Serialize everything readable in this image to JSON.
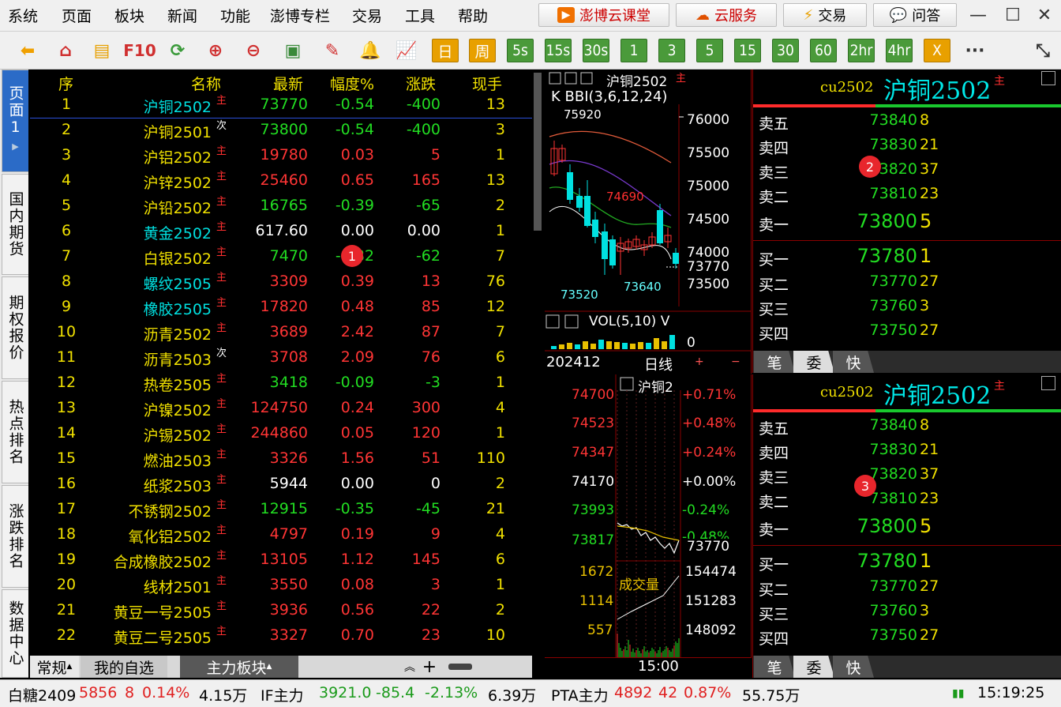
{
  "menu": [
    "系统",
    "页面",
    "板块",
    "新闻",
    "功能",
    "澎博专栏",
    "交易",
    "工具",
    "帮助"
  ],
  "top_buttons": {
    "classroom": "澎博云课堂",
    "cloud": "云服务",
    "trade": "交易",
    "qa": "问答"
  },
  "toolbar_periods": [
    "日",
    "周",
    "5s",
    "15s",
    "30s",
    "1",
    "3",
    "5",
    "15",
    "30",
    "60",
    "2hr",
    "4hr",
    "X"
  ],
  "toolbar_f10": "F10",
  "toolbar_more": "···",
  "side_tabs": [
    {
      "label": "页面1"
    },
    {
      "label": "国内期货"
    },
    {
      "label": "期权报价"
    },
    {
      "label": "热点排名"
    },
    {
      "label": "涨跌排名"
    },
    {
      "label": "数据中心"
    }
  ],
  "table": {
    "headers": {
      "seq": "序",
      "name": "名称",
      "last": "最新",
      "pct": "幅度%",
      "chg": "涨跌",
      "vol": "现手"
    },
    "rows": [
      {
        "seq": "1",
        "name": "沪铜2502",
        "tag": "主",
        "last": "73770",
        "pct": "-0.54",
        "chg": "-400",
        "vol": "13",
        "dir": "down"
      },
      {
        "seq": "2",
        "name": "沪铜2501",
        "tag": "次",
        "last": "73800",
        "pct": "-0.54",
        "chg": "-400",
        "vol": "3",
        "dir": "down"
      },
      {
        "seq": "3",
        "name": "沪铝2502",
        "tag": "主",
        "last": "19780",
        "pct": "0.03",
        "chg": "5",
        "vol": "1",
        "dir": "up"
      },
      {
        "seq": "4",
        "name": "沪锌2502",
        "tag": "主",
        "last": "25460",
        "pct": "0.65",
        "chg": "165",
        "vol": "13",
        "dir": "up"
      },
      {
        "seq": "5",
        "name": "沪铅2502",
        "tag": "主",
        "last": "16765",
        "pct": "-0.39",
        "chg": "-65",
        "vol": "2",
        "dir": "down"
      },
      {
        "seq": "6",
        "name": "黄金2502",
        "tag": "主",
        "last": "617.60",
        "pct": "0.00",
        "chg": "0.00",
        "vol": "1",
        "dir": "flat"
      },
      {
        "seq": "7",
        "name": "白银2502",
        "tag": "主",
        "last": "7470",
        "pct": "-0.82",
        "chg": "-62",
        "vol": "7",
        "dir": "down"
      },
      {
        "seq": "8",
        "name": "螺纹2505",
        "tag": "主",
        "last": "3309",
        "pct": "0.39",
        "chg": "13",
        "vol": "76",
        "dir": "up"
      },
      {
        "seq": "9",
        "name": "橡胶2505",
        "tag": "主",
        "last": "17820",
        "pct": "0.48",
        "chg": "85",
        "vol": "12",
        "dir": "up"
      },
      {
        "seq": "10",
        "name": "沥青2502",
        "tag": "主",
        "last": "3689",
        "pct": "2.42",
        "chg": "87",
        "vol": "7",
        "dir": "up"
      },
      {
        "seq": "11",
        "name": "沥青2503",
        "tag": "次",
        "last": "3708",
        "pct": "2.09",
        "chg": "76",
        "vol": "6",
        "dir": "up"
      },
      {
        "seq": "12",
        "name": "热卷2505",
        "tag": "主",
        "last": "3418",
        "pct": "-0.09",
        "chg": "-3",
        "vol": "1",
        "dir": "down"
      },
      {
        "seq": "13",
        "name": "沪镍2502",
        "tag": "主",
        "last": "124750",
        "pct": "0.24",
        "chg": "300",
        "vol": "4",
        "dir": "up"
      },
      {
        "seq": "14",
        "name": "沪锡2502",
        "tag": "主",
        "last": "244860",
        "pct": "0.05",
        "chg": "120",
        "vol": "1",
        "dir": "up"
      },
      {
        "seq": "15",
        "name": "燃油2503",
        "tag": "主",
        "last": "3326",
        "pct": "1.56",
        "chg": "51",
        "vol": "110",
        "dir": "up"
      },
      {
        "seq": "16",
        "name": "纸浆2503",
        "tag": "主",
        "last": "5944",
        "pct": "0.00",
        "chg": "0",
        "vol": "2",
        "dir": "flat"
      },
      {
        "seq": "17",
        "name": "不锈钢2502",
        "tag": "主",
        "last": "12915",
        "pct": "-0.35",
        "chg": "-45",
        "vol": "21",
        "dir": "down"
      },
      {
        "seq": "18",
        "name": "氧化铝2502",
        "tag": "主",
        "last": "4797",
        "pct": "0.19",
        "chg": "9",
        "vol": "4",
        "dir": "up"
      },
      {
        "seq": "19",
        "name": "合成橡胶2502",
        "tag": "主",
        "last": "13105",
        "pct": "1.12",
        "chg": "145",
        "vol": "6",
        "dir": "up"
      },
      {
        "seq": "20",
        "name": "线材2501",
        "tag": "主",
        "last": "3550",
        "pct": "0.08",
        "chg": "3",
        "vol": "1",
        "dir": "up"
      },
      {
        "seq": "21",
        "name": "黄豆一号2505",
        "tag": "主",
        "last": "3936",
        "pct": "0.56",
        "chg": "22",
        "vol": "2",
        "dir": "up"
      },
      {
        "seq": "22",
        "name": "黄豆二号2505",
        "tag": "主",
        "last": "3327",
        "pct": "0.70",
        "chg": "23",
        "vol": "10",
        "dir": "up"
      }
    ]
  },
  "bottom_tabs": {
    "regular": "常规",
    "mine": "我的自选",
    "main": "主力板块"
  },
  "status": {
    "s1": {
      "name": "白糖2409",
      "price": "5856",
      "chg": "8",
      "pct": "0.14%",
      "vol": "4.15万"
    },
    "s2": {
      "name": "IF主力",
      "price": "3921.0",
      "chg": "-85.4",
      "pct": "-2.13%",
      "vol": "6.39万"
    },
    "s3": {
      "name": "PTA主力",
      "price": "4892",
      "chg": "42",
      "pct": "0.87%",
      "vol": "55.75万"
    },
    "time": "15:19:25"
  },
  "kline": {
    "symbol": "沪铜2502",
    "tag": "主",
    "indicator": "K BBI(3,6,12,24)",
    "y_ticks": [
      "76000",
      "75500",
      "75000",
      "74500",
      "74000",
      "73500"
    ],
    "last_label": "73770",
    "annotations": {
      "high": "75920",
      "mid": "74690",
      "low1": "73520",
      "low2": "73640"
    },
    "vol_indicator": "VOL(5,10) V",
    "vol_value": "0",
    "date": "202412",
    "period": "日线",
    "plus": "+",
    "minus": "−"
  },
  "intraday": {
    "symbol": "沪铜2",
    "left_ticks": [
      "74700",
      "74523",
      "74347",
      "74170",
      "73993",
      "73817"
    ],
    "right_ticks": [
      "+0.71%",
      "+0.48%",
      "+0.24%",
      "+0.00%",
      "-0.24%",
      "-0.48%"
    ],
    "last_label": "73770",
    "vol_label": "成交量",
    "vol_left": [
      "1672",
      "1114",
      "557"
    ],
    "vol_right": [
      "154474",
      "151283",
      "148092"
    ],
    "time": "15:00"
  },
  "orderbook": {
    "code": "cu2502",
    "name": "沪铜2502",
    "tag": "主",
    "asks": [
      {
        "label": "卖五",
        "price": "73840",
        "vol": "8"
      },
      {
        "label": "卖四",
        "price": "73830",
        "vol": "21"
      },
      {
        "label": "卖三",
        "price": "73820",
        "vol": "37"
      },
      {
        "label": "卖二",
        "price": "73810",
        "vol": "23"
      },
      {
        "label": "卖一",
        "price": "73800",
        "vol": "5"
      }
    ],
    "bids": [
      {
        "label": "买一",
        "price": "73780",
        "vol": "1"
      },
      {
        "label": "买二",
        "price": "73770",
        "vol": "27"
      },
      {
        "label": "买三",
        "price": "73760",
        "vol": "3"
      },
      {
        "label": "买四",
        "price": "73750",
        "vol": "27"
      }
    ],
    "footer": [
      "笔",
      "委",
      "快"
    ]
  },
  "markers": [
    "1",
    "2",
    "3"
  ]
}
